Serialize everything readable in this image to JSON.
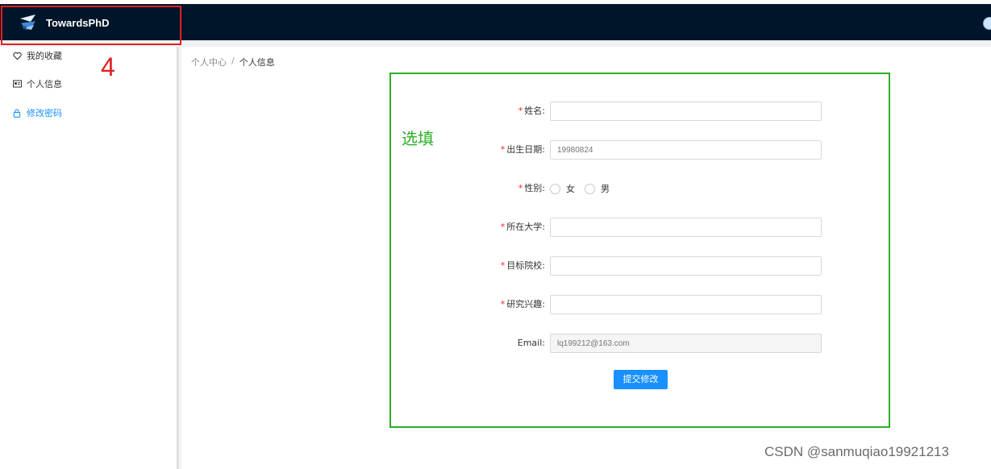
{
  "header": {
    "title": "TowardsPhD",
    "logo_icon": "paper-plane-logo-icon",
    "background": "#001529",
    "right_icon": "user-avatar-icon"
  },
  "annotations": {
    "red_box_number": "4",
    "green_box_label": "选填",
    "red": "#e02020",
    "green": "#2bb024"
  },
  "sidebar": {
    "items": [
      {
        "label": "我的收藏",
        "icon": "heart-icon",
        "active": false
      },
      {
        "label": "个人信息",
        "icon": "id-card-icon",
        "active": false
      },
      {
        "label": "修改密码",
        "icon": "lock-icon",
        "active": true
      }
    ],
    "active_color": "#1890ff"
  },
  "breadcrumb": {
    "root": "个人中心",
    "separator": "/",
    "current": "个人信息"
  },
  "form": {
    "name": {
      "label": "姓名:",
      "required": true,
      "value": "",
      "placeholder": ""
    },
    "birthdate": {
      "label": "出生日期:",
      "required": true,
      "value": "",
      "placeholder": "19980824"
    },
    "gender": {
      "label": "性别:",
      "required": true,
      "options": [
        "女",
        "男"
      ],
      "selected": null
    },
    "university": {
      "label": "所在大学:",
      "required": true,
      "value": "",
      "placeholder": ""
    },
    "target_school": {
      "label": "目标院校:",
      "required": true,
      "value": "",
      "placeholder": ""
    },
    "research_interest": {
      "label": "研究兴趣:",
      "required": true,
      "value": "",
      "placeholder": ""
    },
    "email": {
      "label": "Email:",
      "required": false,
      "value": "",
      "placeholder": "lq199212@163.com",
      "disabled": true
    },
    "required_mark": "*",
    "submit_label": "提交修改"
  },
  "watermark": "CSDN @sanmuqiao19921213"
}
